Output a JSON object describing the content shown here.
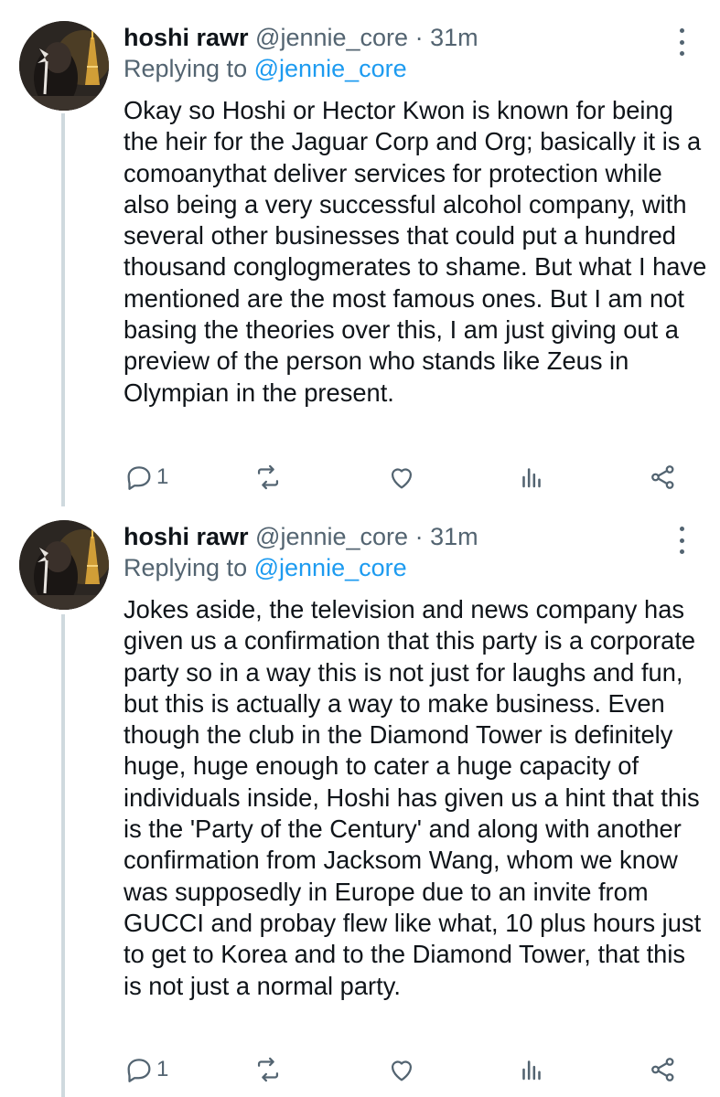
{
  "tweets": [
    {
      "author": {
        "display_name": "hoshi rawr",
        "handle": "@jennie_core"
      },
      "separator": "·",
      "time": "31m",
      "replying_label": "Replying to",
      "replying_handle": "@jennie_core",
      "text": "Okay so Hoshi or Hector Kwon is known for being the heir for the Jaguar Corp and Org; basically it is a comoanythat deliver services for protection while also being a very successful alcohol company, with several other businesses that could put a hundred thousand conglogmerates to shame. But what I have mentioned are the most famous ones. But I am not basing the theories over this, I am just giving out a preview of the person who stands like Zeus in Olympian in the present.",
      "actions": {
        "reply_count": "1",
        "icons": [
          "reply-icon",
          "retweet-icon",
          "like-icon",
          "analytics-icon",
          "share-icon"
        ]
      }
    },
    {
      "author": {
        "display_name": "hoshi rawr",
        "handle": "@jennie_core"
      },
      "separator": "·",
      "time": "31m",
      "replying_label": "Replying to",
      "replying_handle": "@jennie_core",
      "text": "Jokes aside, the television and news company has given us a confirmation that this party is a corporate party so in a way this is not just for laughs and fun, but this is actually a way to make business. Even though the club in the Diamond Tower is definitely huge, huge enough to cater a huge capacity of individuals inside, Hoshi has given us a hint that this is the 'Party of the Century' and along with another confirmation from Jacksom Wang, whom we know was supposedly in Europe due to an invite from GUCCI and probay flew like what, 10 plus hours just to get to Korea and to the Diamond Tower, that this is not just a normal party.",
      "actions": {
        "reply_count": "1",
        "icons": [
          "reply-icon",
          "retweet-icon",
          "like-icon",
          "analytics-icon",
          "share-icon"
        ]
      }
    }
  ],
  "colors": {
    "text": "#0f1419",
    "secondary": "#536471",
    "link": "#1d9bf0",
    "thread_line": "#cfd9de"
  }
}
